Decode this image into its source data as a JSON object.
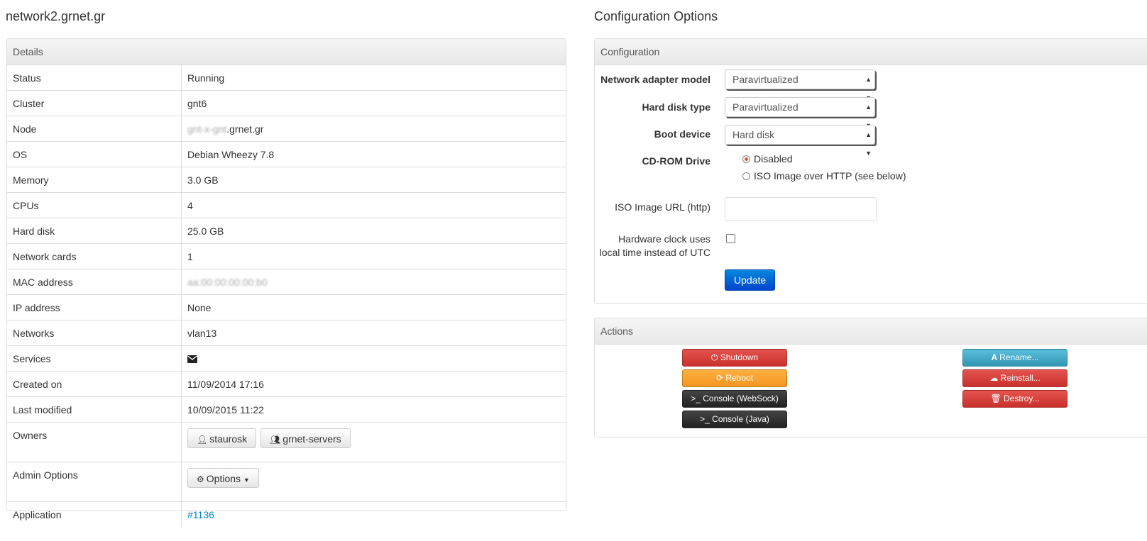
{
  "left": {
    "title": "network2.grnet.gr",
    "panel_heading": "Details",
    "rows": {
      "status": {
        "key": "Status",
        "value": "Running"
      },
      "cluster": {
        "key": "Cluster",
        "value": "gnt6"
      },
      "node": {
        "key": "Node",
        "value_blurred": "gnt-x-gnt",
        "value": ".grnet.gr"
      },
      "os": {
        "key": "OS",
        "value": "Debian Wheezy 7.8"
      },
      "memory": {
        "key": "Memory",
        "value": "3.0 GB"
      },
      "cpus": {
        "key": "CPUs",
        "value": "4"
      },
      "hard_disk": {
        "key": "Hard disk",
        "value": "25.0 GB"
      },
      "network_cards": {
        "key": "Network cards",
        "value": "1"
      },
      "mac": {
        "key": "MAC address",
        "value_blurred": "aa:00:00:00:00:b0"
      },
      "ip": {
        "key": "IP address",
        "value": "None"
      },
      "networks": {
        "key": "Networks",
        "value": "vlan13"
      },
      "services": {
        "key": "Services",
        "icon": "envelope-icon"
      },
      "created": {
        "key": "Created on",
        "value": "11/09/2014 17:16"
      },
      "modified": {
        "key": "Last modified",
        "value": "10/09/2015 11:22"
      },
      "owners": {
        "key": "Owners",
        "user": "staurosk",
        "group": "grnet-servers"
      },
      "admin": {
        "key": "Admin Options",
        "button": "Options"
      },
      "application": {
        "key": "Application",
        "link": "#1136"
      }
    }
  },
  "right": {
    "title": "Configuration Options",
    "config": {
      "heading": "Configuration",
      "nic_label": "Network adapter model",
      "nic_value": "Paravirtualized",
      "disk_label": "Hard disk type",
      "disk_value": "Paravirtualized",
      "boot_label": "Boot device",
      "boot_value": "Hard disk",
      "cdrom_label": "CD-ROM Drive",
      "cdrom_opt1": "Disabled",
      "cdrom_opt2": "ISO Image over HTTP (see below)",
      "iso_label": "ISO Image URL (http)",
      "iso_value": "",
      "hwclock_label_1": "Hardware clock uses",
      "hwclock_label_2": "local time instead of UTC",
      "update": "Update"
    },
    "actions": {
      "heading": "Actions",
      "shutdown": "Shutdown",
      "reboot": "Reboot",
      "console_ws": ">_ Console (WebSock)",
      "console_java": ">_ Console (Java)",
      "rename": "Rename...",
      "reinstall": "Reinstall...",
      "destroy": "Destroy..."
    },
    "colors": {
      "danger": "#d9534f",
      "warning": "#f89406",
      "inverse": "#222222",
      "info": "#49afcd",
      "primary": "#0055cc",
      "link": "#0088cc"
    }
  }
}
